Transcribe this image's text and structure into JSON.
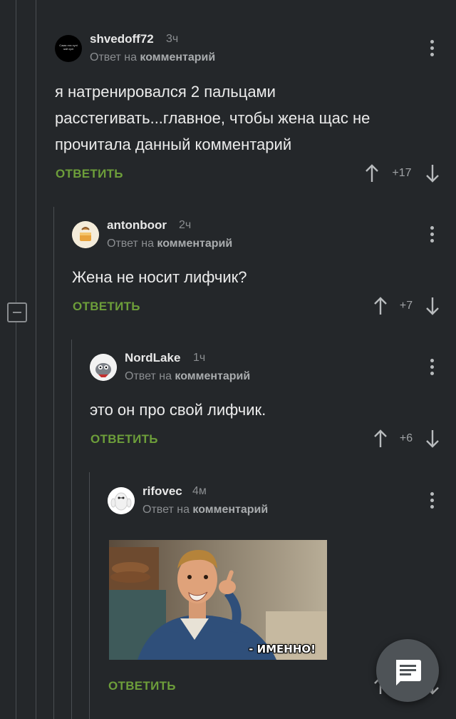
{
  "comments": [
    {
      "username": "shvedoff72",
      "time": "3ч",
      "reply_prefix": "Ответ на",
      "reply_target": "комментарий",
      "lines": [
        "я натренировался 2 пальцами",
        "расстегивать...главное, чтобы жена щас не",
        "прочитала данный комментарий"
      ],
      "reply_label": "ОТВЕТИТЬ",
      "score": "+17",
      "avatar_text": "Сама эта хулi зай хулi"
    },
    {
      "username": "antonboor",
      "time": "2ч",
      "reply_prefix": "Ответ на",
      "reply_target": "комментарий",
      "lines": [
        "Жена не носит лифчик?"
      ],
      "reply_label": "ОТВЕТИТЬ",
      "score": "+7"
    },
    {
      "username": "NordLake",
      "time": "1ч",
      "reply_prefix": "Ответ на",
      "reply_target": "комментарий",
      "lines": [
        "это он про свой лифчик."
      ],
      "reply_label": "ОТВЕТИТЬ",
      "score": "+6"
    },
    {
      "username": "rifovec",
      "time": "4м",
      "reply_prefix": "Ответ на",
      "reply_target": "комментарий",
      "gif_caption": "- ИМЕННО!",
      "reply_label": "ОТВЕТИТЬ"
    }
  ],
  "icons": {
    "collapse": "minus-square-icon",
    "fab": "comment-icon",
    "menu": "more-vertical-icon",
    "upvote": "arrow-up-icon",
    "downvote": "arrow-down-icon"
  },
  "colors": {
    "background": "#24272a",
    "accent_green": "#6d9e3a",
    "text": "#ececec",
    "muted": "#8b8e91"
  }
}
